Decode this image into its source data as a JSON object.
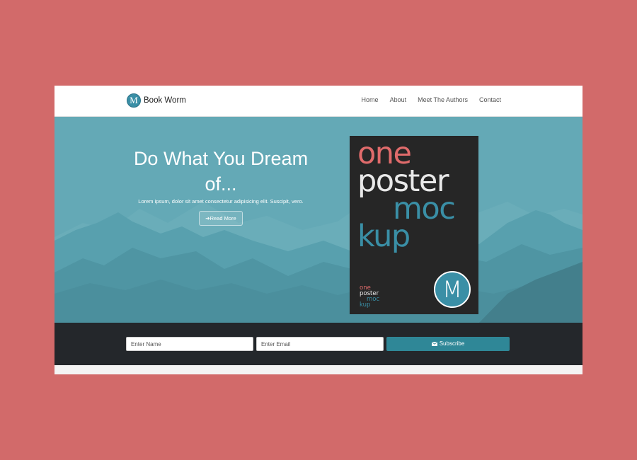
{
  "navbar": {
    "brand_logo_letter": "M",
    "brand_name": "Book Worm",
    "links": [
      "Home",
      "About",
      "Meet The Authors",
      "Contact"
    ]
  },
  "hero": {
    "title": "Do What You Dream of...",
    "text": "Lorem ipsum, dolor sit amet consectetur adipisicing elit. Suscipit, vero.",
    "read_more_label": "Read More"
  },
  "poster": {
    "lines": [
      "one",
      "poster",
      "moc",
      "kup"
    ],
    "logo_letter": "M"
  },
  "subscribe": {
    "name_placeholder": "Enter Name",
    "email_placeholder": "Enter Email",
    "button_label": "Subscribe"
  },
  "colors": {
    "page_background": "#d26a6a",
    "hero_tint": "#5fa6b3",
    "accent": "#3a8fa6",
    "poster_red": "#e06b6b",
    "subscribe_bar": "#24272b",
    "subscribe_button": "#2f8797"
  },
  "icons": {
    "read_more": "arrow-right-icon",
    "subscribe": "envelope-icon"
  }
}
